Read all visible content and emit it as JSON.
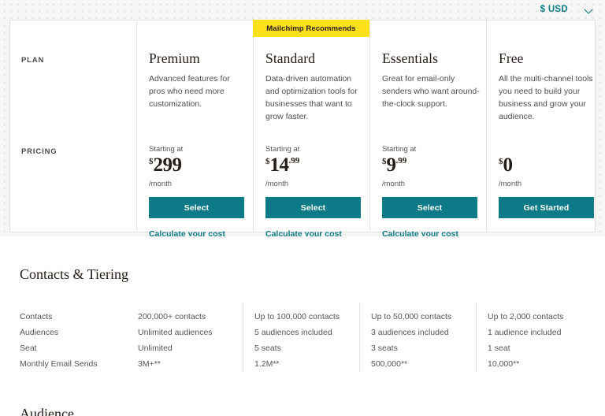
{
  "header": {
    "currency_label": "$ USD",
    "currency_chevron_icon": "chevron-down-icon"
  },
  "pricing_card": {
    "row_labels": {
      "plan": "PLAN",
      "pricing": "PRICING"
    },
    "plans": [
      {
        "name": "Premium",
        "description": "Advanced features for pros who need more customization.",
        "badge": null,
        "starting_at": "Starting at",
        "currency_symbol": "$",
        "amount": "299",
        "cents": "",
        "per": "/month",
        "cta_label": "Select",
        "secondary_link": "Calculate your cost"
      },
      {
        "name": "Standard",
        "description": "Data-driven automation and optimization tools for businesses that want to grow faster.",
        "badge": "Mailchimp Recommends",
        "starting_at": "Starting at",
        "currency_symbol": "$",
        "amount": "14",
        "cents": ".99",
        "per": "/month",
        "cta_label": "Select",
        "secondary_link": "Calculate your cost"
      },
      {
        "name": "Essentials",
        "description": "Great for email-only senders who want around-the-clock support.",
        "badge": null,
        "starting_at": "Starting at",
        "currency_symbol": "$",
        "amount": "9",
        "cents": ".99",
        "per": "/month",
        "cta_label": "Select",
        "secondary_link": "Calculate your cost"
      },
      {
        "name": "Free",
        "description": "All the multi-channel tools you need to build your business and grow your audience.",
        "badge": null,
        "starting_at": "",
        "currency_symbol": "$",
        "amount": "0",
        "cents": "",
        "per": "/month",
        "cta_label": "Get Started",
        "secondary_link": ""
      }
    ]
  },
  "tiering": {
    "title": "Contacts & Tiering",
    "row_labels": [
      "Contacts",
      "Audiences",
      "Seat",
      "Monthly Email Sends"
    ],
    "columns": [
      {
        "plan": "Premium",
        "values": [
          "200,000+ contacts",
          "Unlimited audiences",
          "Unlimited",
          "3M+**"
        ]
      },
      {
        "plan": "Standard",
        "values": [
          "Up to 100,000 contacts",
          "5 audiences included",
          "5 seats",
          "1.2M**"
        ]
      },
      {
        "plan": "Essentials",
        "values": [
          "Up to 50,000 contacts",
          "3 audiences included",
          "3 seats",
          "500,000**"
        ]
      },
      {
        "plan": "Free",
        "values": [
          "Up to 2,000 contacts",
          "1 audience included",
          "1 seat",
          "10,000**"
        ]
      }
    ]
  },
  "next_section": {
    "title": "Audience"
  },
  "colors": {
    "accent_teal": "#0d7b87",
    "badge_yellow": "#ffe01b",
    "text_dark": "#241c15",
    "text_muted": "#55554f",
    "border": "#e0e0dc"
  }
}
